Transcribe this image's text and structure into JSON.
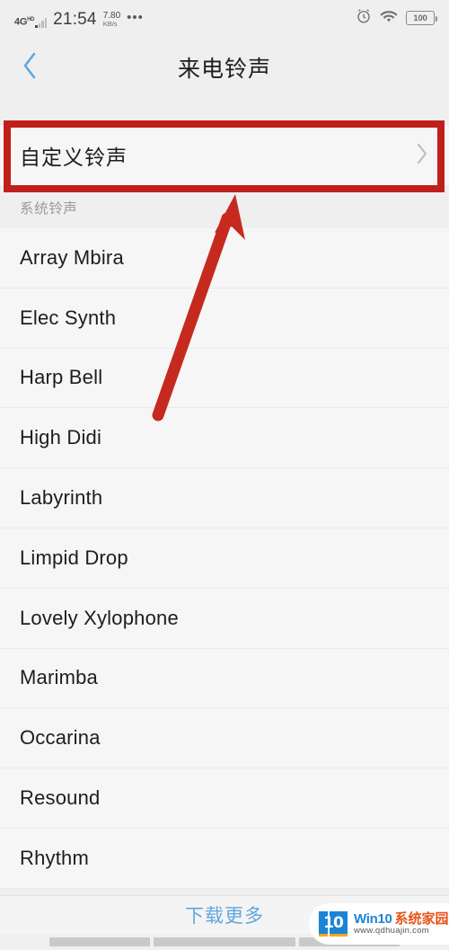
{
  "statusbar": {
    "network_type": "4G",
    "network_suffix": "HD",
    "time": "21:54",
    "netspeed_value": "7.80",
    "netspeed_unit": "KB/s",
    "more_dots": "•••",
    "alarm_icon": "alarm-clock-icon",
    "wifi_icon": "wifi-icon",
    "battery_level": "100"
  },
  "titlebar": {
    "back_icon": "chevron-left-icon",
    "title": "来电铃声"
  },
  "custom_row": {
    "label": "自定义铃声",
    "chevron_icon": "chevron-right-icon"
  },
  "section": {
    "header": "系统铃声"
  },
  "ringtones": [
    "Array Mbira",
    "Elec Synth",
    "Harp Bell",
    "High Didi",
    "Labyrinth",
    "Limpid Drop",
    "Lovely Xylophone",
    "Marimba",
    "Occarina",
    "Resound",
    "Rhythm"
  ],
  "footer": {
    "download_more": "下载更多"
  },
  "navbar": {
    "recents_icon": "recents-nav-icon",
    "home_icon": "home-nav-icon",
    "back_icon": "back-nav-icon"
  },
  "watermark": {
    "logo_text": "10",
    "brand": "Win10",
    "brand_cn": "系统家园",
    "url": "www.qdhuajin.com"
  },
  "annotations": {
    "highlight_color": "#c0201a",
    "arrow_color": "#c62a1e",
    "accent_blue": "#5fa8dd"
  }
}
